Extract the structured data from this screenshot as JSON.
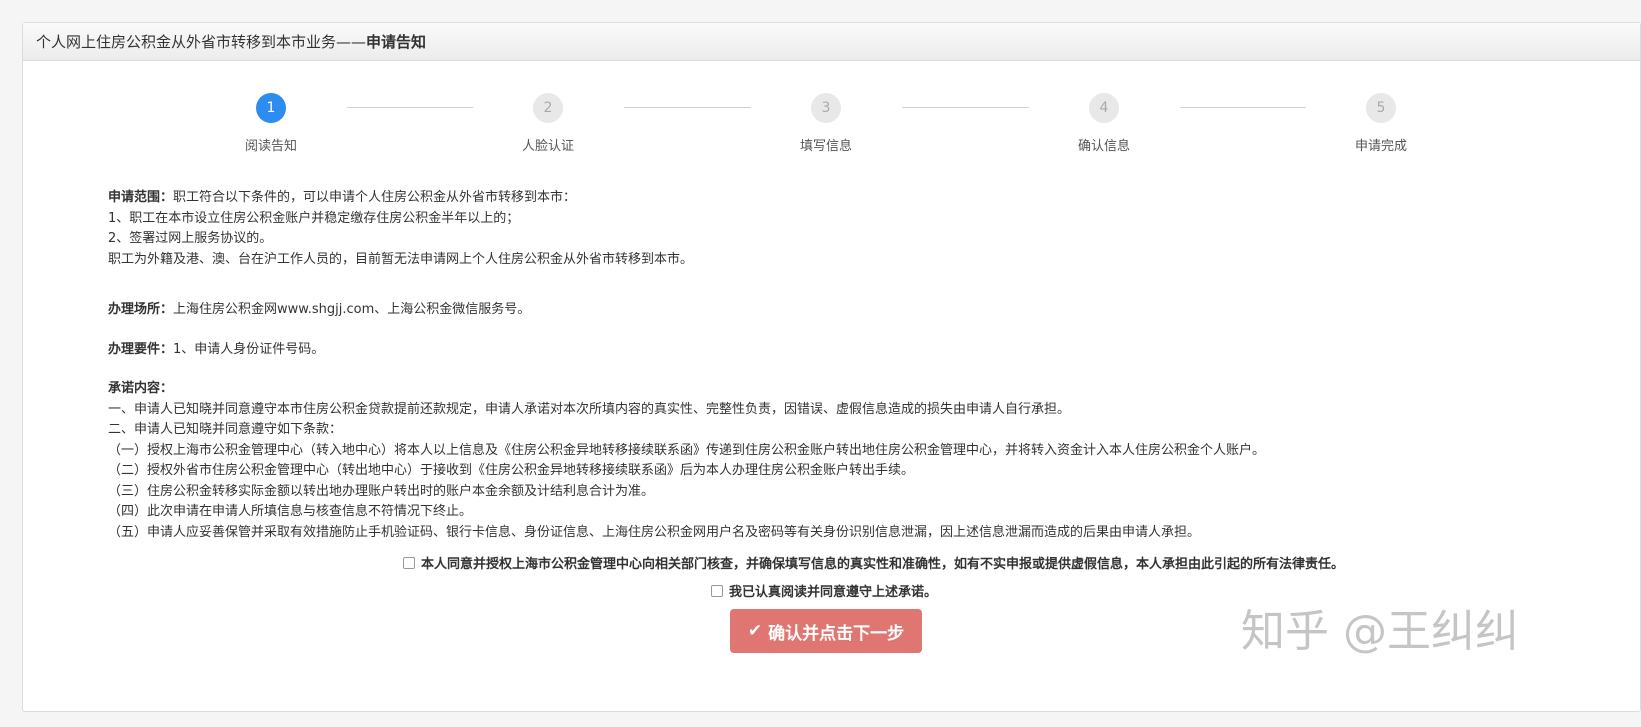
{
  "header": {
    "title_prefix": "个人网上住房公积金从外省市转移到本市业务——",
    "title_bold": "申请告知"
  },
  "steps": [
    {
      "number": "1",
      "label": "阅读告知",
      "active": true
    },
    {
      "number": "2",
      "label": "人脸认证",
      "active": false
    },
    {
      "number": "3",
      "label": "填写信息",
      "active": false
    },
    {
      "number": "4",
      "label": "确认信息",
      "active": false
    },
    {
      "number": "5",
      "label": "申请完成",
      "active": false
    }
  ],
  "scope": {
    "label": "申请范围：",
    "intro": "职工符合以下条件的，可以申请个人住房公积金从外省市转移到本市：",
    "lines": [
      "1、职工在本市设立住房公积金账户并稳定缴存住房公积金半年以上的；",
      "2、签署过网上服务协议的。",
      "职工为外籍及港、澳、台在沪工作人员的，目前暂无法申请网上个人住房公积金从外省市转移到本市。"
    ]
  },
  "place": {
    "label": "办理场所：",
    "text": "上海住房公积金网www.shgjj.com、上海公积金微信服务号。"
  },
  "requirements": {
    "label": "办理要件：",
    "text": "1、申请人身份证件号码。"
  },
  "promise": {
    "label": "承诺内容：",
    "lines": [
      "一、申请人已知晓并同意遵守本市住房公积金贷款提前还款规定，申请人承诺对本次所填内容的真实性、完整性负责，因错误、虚假信息造成的损失由申请人自行承担。",
      "二、申请人已知晓并同意遵守如下条款：",
      "（一）授权上海市公积金管理中心（转入地中心）将本人以上信息及《住房公积金异地转移接续联系函》传递到住房公积金账户转出地住房公积金管理中心，并将转入资金计入本人住房公积金个人账户。",
      "（二）授权外省市住房公积金管理中心（转出地中心）于接收到《住房公积金异地转移接续联系函》后为本人办理住房公积金账户转出手续。",
      "（三）住房公积金转移实际金额以转出地办理账户转出时的账户本金余额及计结利息合计为准。",
      "（四）此次申请在申请人所填信息与核查信息不符情况下终止。",
      "（五）申请人应妥善保管并采取有效措施防止手机验证码、银行卡信息、身份证信息、上海住房公积金网用户名及密码等有关身份识别信息泄漏，因上述信息泄漏而造成的后果由申请人承担。"
    ]
  },
  "agreements": {
    "authorize": "本人同意并授权上海市公积金管理中心向相关部门核查，并确保填写信息的真实性和准确性，如有不实申报或提供虚假信息，本人承担由此引起的所有法律责任。",
    "read": "我已认真阅读并同意遵守上述承诺。"
  },
  "button": {
    "icon": "check-icon",
    "label": "确认并点击下一步",
    "color": "#e07672"
  },
  "watermark": "知乎 @王纠纠",
  "colors": {
    "active_step": "#2d8cf0",
    "inactive_step": "#e8e8e8"
  }
}
